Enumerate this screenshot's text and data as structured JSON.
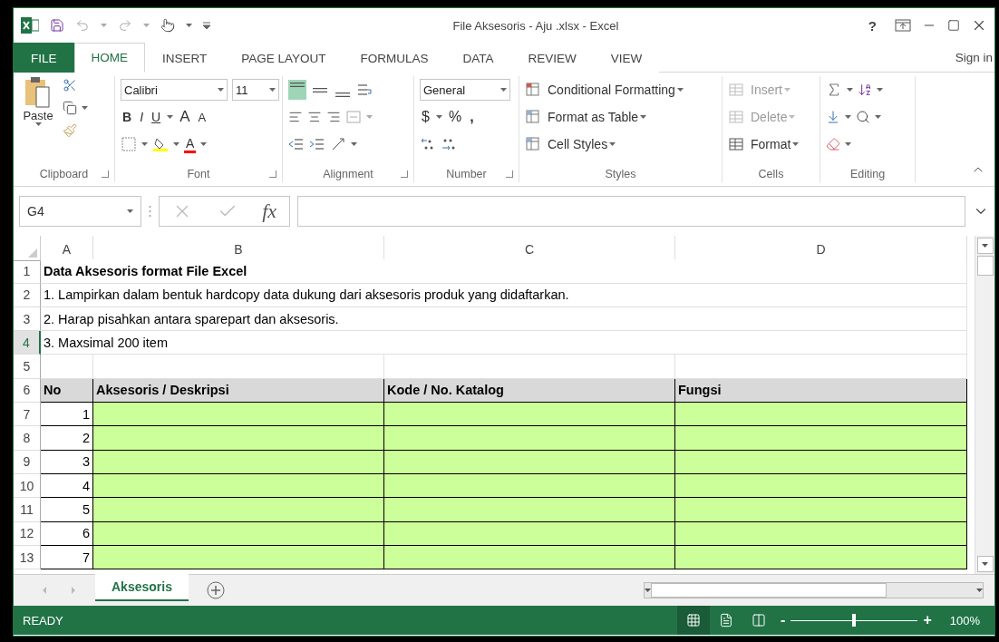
{
  "window": {
    "title": "File Aksesoris - Aju .xlsx - Excel",
    "help": "?"
  },
  "ribbon_tabs": [
    {
      "label": "FILE",
      "kind": "file",
      "selected": false
    },
    {
      "label": "HOME",
      "kind": "tab",
      "selected": true
    },
    {
      "label": "INSERT",
      "kind": "tab",
      "selected": false
    },
    {
      "label": "PAGE LAYOUT",
      "kind": "tab",
      "selected": false
    },
    {
      "label": "FORMULAS",
      "kind": "tab",
      "selected": false
    },
    {
      "label": "DATA",
      "kind": "tab",
      "selected": false
    },
    {
      "label": "REVIEW",
      "kind": "tab",
      "selected": false
    },
    {
      "label": "VIEW",
      "kind": "tab",
      "selected": false
    }
  ],
  "sign_in": "Sign in",
  "ribbon": {
    "clipboard": {
      "label": "Clipboard",
      "paste": "Paste"
    },
    "font": {
      "label": "Font",
      "font_name": "Calibri",
      "font_size": "11",
      "bold": "B",
      "italic": "I",
      "underline": "U",
      "grow": "A",
      "shrink": "A",
      "font_color": "A"
    },
    "alignment": {
      "label": "Alignment",
      "vertical_align": [
        {
          "selected": true
        },
        {
          "selected": false
        },
        {
          "selected": false
        }
      ]
    },
    "number": {
      "label": "Number",
      "format": "General",
      "currency": "$",
      "percent": "%",
      "comma": ","
    },
    "styles": {
      "label": "Styles",
      "items": [
        "Conditional Formatting",
        "Format as Table",
        "Cell Styles"
      ]
    },
    "cells": {
      "label": "Cells",
      "items": [
        {
          "label": "Insert",
          "disabled": true
        },
        {
          "label": "Delete",
          "disabled": true
        },
        {
          "label": "Format",
          "disabled": false
        }
      ]
    },
    "editing": {
      "label": "Editing"
    }
  },
  "formula_bar": {
    "name_box": "G4",
    "fx": "fx"
  },
  "columns": [
    "A",
    "B",
    "C",
    "D"
  ],
  "rows": [
    {
      "number": "1",
      "selected": false,
      "kind": "title",
      "text": "Data Aksesoris format File Excel"
    },
    {
      "number": "2",
      "selected": false,
      "kind": "note",
      "text": "1. Lampirkan dalam bentuk hardcopy data dukung dari aksesoris produk yang didaftarkan."
    },
    {
      "number": "3",
      "selected": false,
      "kind": "note",
      "text": "2. Harap pisahkan antara sparepart dan aksesoris."
    },
    {
      "number": "4",
      "selected": true,
      "kind": "note",
      "text": "3. Maxsimal 200 item"
    },
    {
      "number": "5",
      "selected": false,
      "kind": "blank"
    },
    {
      "number": "6",
      "selected": false,
      "kind": "header",
      "cells": [
        "No",
        "Aksesoris / Deskripsi",
        "Kode / No. Katalog",
        "Fungsi"
      ]
    },
    {
      "number": "7",
      "selected": false,
      "kind": "data",
      "cells": [
        "1"
      ]
    },
    {
      "number": "8",
      "selected": false,
      "kind": "data",
      "cells": [
        "2"
      ]
    },
    {
      "number": "9",
      "selected": false,
      "kind": "data",
      "cells": [
        "3"
      ]
    },
    {
      "number": "10",
      "selected": false,
      "kind": "data",
      "cells": [
        "4"
      ]
    },
    {
      "number": "11",
      "selected": false,
      "kind": "data",
      "cells": [
        "5"
      ]
    },
    {
      "number": "12",
      "selected": false,
      "kind": "data",
      "cells": [
        "6"
      ]
    },
    {
      "number": "13",
      "selected": false,
      "kind": "data",
      "cells": [
        "7"
      ]
    }
  ],
  "sheet_tabs": [
    {
      "label": "Aksesoris",
      "selected": true
    }
  ],
  "status_bar": {
    "status": "READY",
    "views": [
      {
        "selected": true
      },
      {
        "selected": false
      },
      {
        "selected": false
      }
    ],
    "zoom_minus": "-",
    "zoom_plus": "+",
    "zoom": {
      "level": 0.5
    },
    "zoom_label": "100%"
  }
}
